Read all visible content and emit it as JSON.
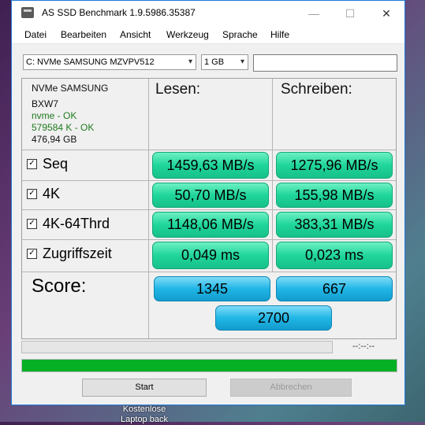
{
  "window": {
    "title": "AS SSD Benchmark 1.9.5986.35387"
  },
  "titlebar_controls": {
    "minimize": "—",
    "maximize": "☐",
    "close": "✕"
  },
  "menu": [
    "Datei",
    "Bearbeiten",
    "Ansicht",
    "Werkzeug",
    "Sprache",
    "Hilfe"
  ],
  "drive_select": {
    "value": "C: NVMe SAMSUNG MZVPV512"
  },
  "size_select": {
    "value": "1 GB"
  },
  "filter_input": {
    "value": ""
  },
  "drive_info": {
    "model": "NVMe SAMSUNG",
    "firmware": "BXW7",
    "driver_status": "nvme - OK",
    "alignment_status": "579584 K - OK",
    "capacity": "476,94 GB"
  },
  "columns": {
    "read": "Lesen:",
    "write": "Schreiben:"
  },
  "rows": [
    {
      "label": "Seq",
      "checked": true,
      "read": "1459,63 MB/s",
      "write": "1275,96 MB/s"
    },
    {
      "label": "4K",
      "checked": true,
      "read": "50,70 MB/s",
      "write": "155,98 MB/s"
    },
    {
      "label": "4K-64Thrd",
      "checked": true,
      "read": "1148,06 MB/s",
      "write": "383,31 MB/s"
    },
    {
      "label": "Zugriffszeit",
      "checked": true,
      "read": "0,049 ms",
      "write": "0,023 ms"
    }
  ],
  "score": {
    "label": "Score:",
    "read": "1345",
    "write": "667",
    "total": "2700"
  },
  "progress": {
    "elapsed": "--:--:--",
    "test_progress_fraction": 0.0,
    "overall_progress_fraction": 1.0
  },
  "buttons": {
    "start": "Start",
    "cancel": "Abbrechen"
  },
  "desktop_icon_label": "Kostenlose Laptop back",
  "colors": {
    "result_green": "#1fd69a",
    "score_blue": "#21b6e6",
    "progress_green": "#06b025"
  }
}
